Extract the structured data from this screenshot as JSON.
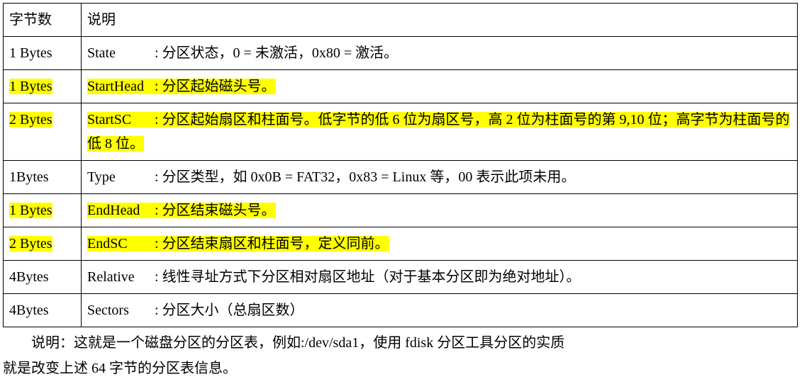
{
  "table": {
    "header": {
      "bytes": "字节数",
      "desc": "说明"
    },
    "rows": [
      {
        "bytes": "1 Bytes",
        "field": "State",
        "sep": ": ",
        "text": "分区状态，0 = 未激活，0x80 = 激活。",
        "hl": false
      },
      {
        "bytes": "1 Bytes",
        "field": "StartHead",
        "sep": ": ",
        "text": "分区起始磁头号。",
        "hl": true
      },
      {
        "bytes": "2 Bytes",
        "field": "StartSC",
        "sep": ": ",
        "text": "分区起始扇区和柱面号。低字节的低 6 位为扇区号，高 2 位为柱面号的第 9,10 位；高字节为柱面号的低 8 位。",
        "hl": true
      },
      {
        "bytes": "1Bytes",
        "field": "Type",
        "sep": ": ",
        "text": "分区类型，如 0x0B = FAT32，0x83 = Linux 等，00 表示此项未用。",
        "hl": false
      },
      {
        "bytes": "1 Bytes",
        "field": "EndHead",
        "sep": ": ",
        "text": "分区结束磁头号。",
        "hl": true
      },
      {
        "bytes": "2 Bytes",
        "field": "EndSC",
        "sep": ": ",
        "text": "分区结束扇区和柱面号，定义同前。",
        "hl": true
      },
      {
        "bytes": "4Bytes",
        "field": "Relative",
        "sep": ": ",
        "text": "线性寻址方式下分区相对扇区地址（对于基本分区即为绝对地址）。",
        "hl": false
      },
      {
        "bytes": "4Bytes",
        "field": " Sectors",
        "sep": ": ",
        "text": "分区大小（总扇区数）",
        "hl": false
      }
    ]
  },
  "note": {
    "line1": "说明：这就是一个磁盘分区的分区表，例如:/dev/sda1，使用 fdisk 分区工具分区的实质",
    "line2": "就是改变上述 64 字节的分区表信息。"
  }
}
